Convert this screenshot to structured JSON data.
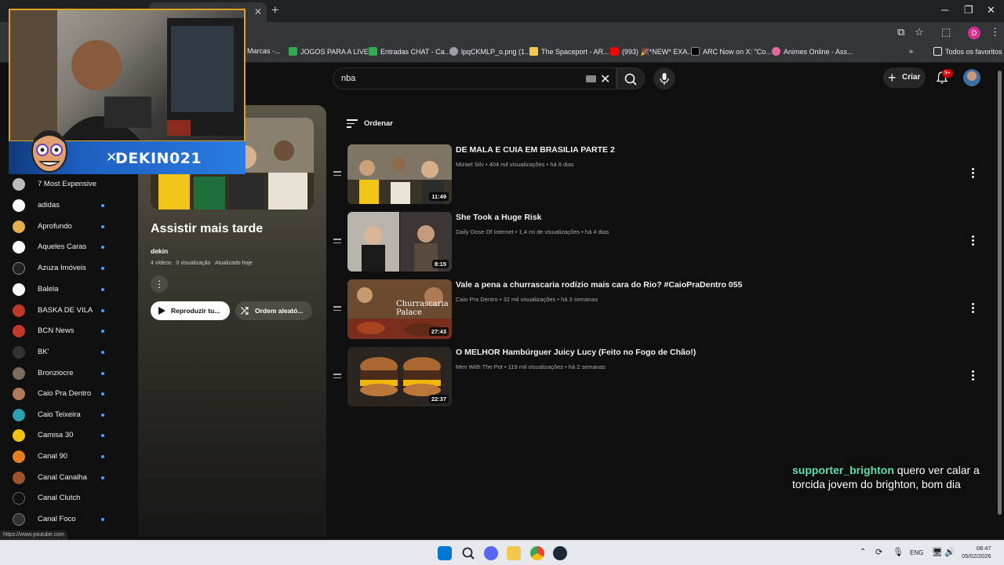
{
  "browser": {
    "active_tab": "",
    "bookmarks": [
      {
        "label": "Marcas -...",
        "color": "#35363a"
      },
      {
        "label": "JOGOS PARA A LIVE...",
        "color": "#34a853"
      },
      {
        "label": "Entradas CHAT - Ca...",
        "color": "#34a853"
      },
      {
        "label": "lpqCKMLP_o.png (1...",
        "color": "#9aa0a6"
      },
      {
        "label": "The Spaceport - AR...",
        "color": "#f9c74f"
      },
      {
        "label": "(993) 🎉*NEW* EXA...",
        "color": "#ff0000"
      },
      {
        "label": "ARC Now on X: \"Co...",
        "color": "#000000"
      },
      {
        "label": "Animes Online - Ass...",
        "color": "#e06c9f"
      }
    ],
    "all_bookmarks": "Todos os favoritos",
    "profile_initial": "D"
  },
  "header": {
    "search_value": "nba",
    "create_label": "Criar",
    "notifications_badge": "9+"
  },
  "sidebar": {
    "items": [
      {
        "label": "7 Most Expensive",
        "color": "#bbbbbb",
        "dot": false
      },
      {
        "label": "adidas",
        "color": "#ffffff",
        "dot": true
      },
      {
        "label": "Aprofundo",
        "color": "#e3b04b",
        "dot": true
      },
      {
        "label": "Aqueles Caras",
        "color": "#ffffff",
        "dot": true
      },
      {
        "label": "Azuza Imóveis",
        "color": "#222222",
        "dot": true
      },
      {
        "label": "Balela",
        "color": "#ffffff",
        "dot": true
      },
      {
        "label": "BASKA DE VILA",
        "color": "#c0392b",
        "dot": true
      },
      {
        "label": "BCN News",
        "color": "#c0392b",
        "dot": true
      },
      {
        "label": "BK'",
        "color": "#333333",
        "dot": true
      },
      {
        "label": "Bronziocre",
        "color": "#7d6b5d",
        "dot": true
      },
      {
        "label": "Caio Pra Dentro",
        "color": "#b07a5a",
        "dot": true
      },
      {
        "label": "Caio Teixeira",
        "color": "#2aa1b3",
        "dot": true
      },
      {
        "label": "Camisa 30",
        "color": "#f1c40f",
        "dot": true
      },
      {
        "label": "Canal 90",
        "color": "#e67e22",
        "dot": true
      },
      {
        "label": "Canal Canalha",
        "color": "#a0522d",
        "dot": true
      },
      {
        "label": "Canal Clutch",
        "color": "#111111",
        "dot": true
      },
      {
        "label": "Canal Foco",
        "color": "#333333",
        "dot": true
      }
    ]
  },
  "playlist": {
    "title": "Assistir mais tarde",
    "owner": "dekin",
    "video_count": "4 vídeos",
    "views": "0 visualização",
    "updated": "Atualizado hoje",
    "play_label": "Reproduzir tu...",
    "shuffle_label": "Ordem aleató..."
  },
  "sort_label": "Ordenar",
  "videos": [
    {
      "title": "DE MALA E CUIA EM BRASILIA PARTE 2",
      "channel": "Mizael Silv",
      "views": "404 mil visualizações",
      "age": "há 8 dias",
      "duration": "11:49"
    },
    {
      "title": "She Took a Huge Risk",
      "channel": "Daily Dose Of Internet",
      "views": "1,4 mi de visualizações",
      "age": "há 4 dias",
      "duration": "8:15"
    },
    {
      "title": "Vale a pena a churrascaria rodízio mais cara do Rio? #CaioPraDentro 055",
      "channel": "Caio Pra Dentro",
      "views": "32 mil visualizações",
      "age": "há 3 semanas",
      "duration": "27:43",
      "thumb_text": "Churrascaria Palace"
    },
    {
      "title": "O MELHOR Hambúrguer Juicy Lucy (Feito no Fogo de Chão!)",
      "channel": "Men With The Pot",
      "views": "119 mil visualizações",
      "age": "há 2 semanas",
      "duration": "22:37"
    }
  ],
  "stream": {
    "handle": "DEKIN021",
    "chat_user": "supporter_brighton",
    "chat_message": "quero ver calar a torcida jovem do brighton, bom dia"
  },
  "status_url": "https://www.youtube.com",
  "taskbar": {
    "language": "ENG",
    "time": "08:47",
    "date": "05/02/2026"
  }
}
